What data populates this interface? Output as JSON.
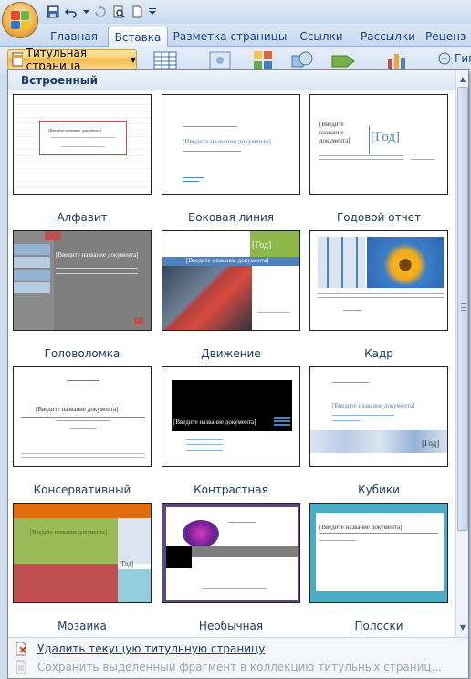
{
  "ribbon_tabs": [
    "Главная",
    "Вставка",
    "Разметка страницы",
    "Ссылки",
    "Рассылки",
    "Реценз"
  ],
  "active_tab": "Вставка",
  "cover_page_button": "Титульная страница",
  "partial_label": "Гип",
  "gallery": {
    "section_header": "Встроенный",
    "items": [
      {
        "caption": "Алфавит"
      },
      {
        "caption": "Боковая линия"
      },
      {
        "caption": "Годовой отчет"
      },
      {
        "caption": "Головоломка"
      },
      {
        "caption": "Движение"
      },
      {
        "caption": "Кадр"
      },
      {
        "caption": "Консервативный"
      },
      {
        "caption": "Контрастная"
      },
      {
        "caption": "Кубики"
      },
      {
        "caption": "Мозаика"
      },
      {
        "caption": "Необычная"
      },
      {
        "caption": "Полоски"
      }
    ]
  },
  "thumb_text": {
    "title_placeholder": "[Введите название документа]",
    "year_placeholder": "[Год]"
  },
  "footer": {
    "remove_label": "Удалить текущую титульную страницу",
    "save_label": "Сохранить выделенный фрагмент в коллекцию титульных страниц..."
  },
  "colors": {
    "accent_blue": "#4f81bd",
    "motion_green": "#8cb94a",
    "puzzle_red": "#c0504d",
    "mosaic_orange": "#e46c0a",
    "mosaic_green": "#9bbb59",
    "mosaic_red": "#c0504d",
    "mosaic_cyan": "#92cddc",
    "stripes_teal": "#4bacc6",
    "unusual_purple": "#5f497a"
  }
}
